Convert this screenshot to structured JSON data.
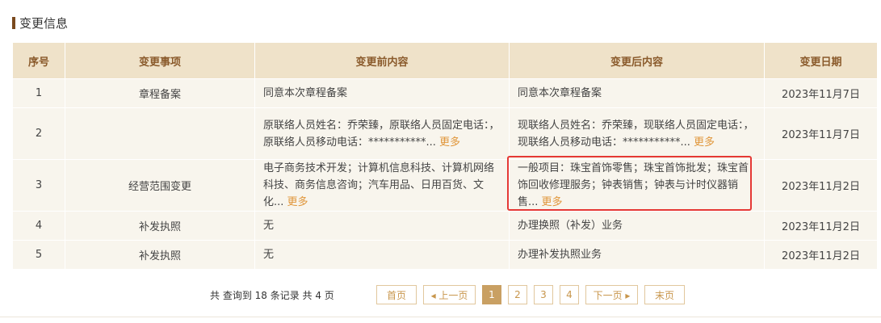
{
  "section": {
    "title": "变更信息"
  },
  "table": {
    "headers": [
      "序号",
      "变更事项",
      "变更前内容",
      "变更后内容",
      "变更日期"
    ],
    "rows": [
      {
        "idx": "1",
        "item": "章程备案",
        "before": "同意本次章程备案",
        "before_more": "",
        "after": "同意本次章程备案",
        "after_more": "",
        "date": "2023年11月7日"
      },
      {
        "idx": "2",
        "item": "",
        "before": "原联络人员姓名：乔荣臻，原联络人员固定电话：，原联络人员移动电话：***********...",
        "before_more": "更多",
        "after": "现联络人员姓名：乔荣臻，现联络人员固定电话：，现联络人员移动电话：***********...",
        "after_more": "更多",
        "date": "2023年11月7日"
      },
      {
        "idx": "3",
        "item": "经营范围变更",
        "before": "电子商务技术开发；计算机信息科技、计算机网络科技、商务信息咨询；汽车用品、日用百货、文化...",
        "before_more": "更多",
        "after": "一般项目：珠宝首饰零售；珠宝首饰批发；珠宝首饰回收修理服务；钟表销售；钟表与计时仪器销售...",
        "after_more": "更多",
        "date": "2023年11月2日"
      },
      {
        "idx": "4",
        "item": "补发执照",
        "before": "无",
        "before_more": "",
        "after": "办理换照（补发）业务",
        "after_more": "",
        "date": "2023年11月2日"
      },
      {
        "idx": "5",
        "item": "补发执照",
        "before": "无",
        "before_more": "",
        "after": "办理补发执照业务",
        "after_more": "",
        "date": "2023年11月2日"
      }
    ]
  },
  "pager": {
    "info": "共 查询到 18 条记录 共 4 页",
    "first": "首页",
    "prev": "◂ 上一页",
    "pages": [
      "1",
      "2",
      "3",
      "4"
    ],
    "active_page": "1",
    "next": "下一页 ▸",
    "last": "末页"
  },
  "colors": {
    "accent": "#c9a063",
    "header_bg": "#efe2c9",
    "row_bg": "#f8f5ed",
    "link": "#e0963a",
    "highlight": "#e53935"
  }
}
